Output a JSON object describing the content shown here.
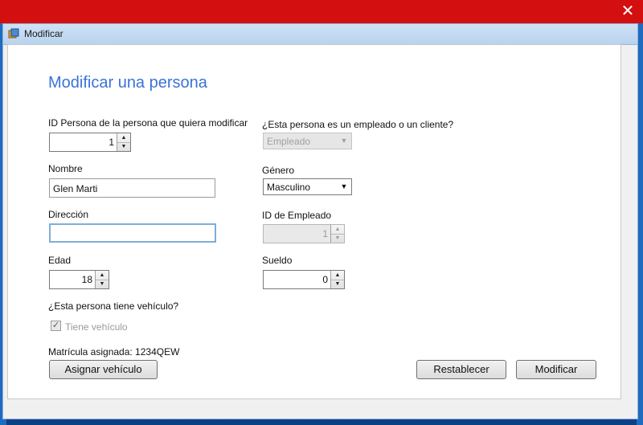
{
  "outer_window": {
    "close_symbol": "✕"
  },
  "dialog": {
    "title": "Modificar",
    "icon": "java-app-icon"
  },
  "form": {
    "heading": "Modificar una persona",
    "id_persona": {
      "label": "ID Persona de la persona que quiera modificar",
      "value": "1"
    },
    "nombre": {
      "label": "Nombre",
      "value": "Glen Marti"
    },
    "direccion": {
      "label": "Dirección",
      "value": ""
    },
    "edad": {
      "label": "Edad",
      "value": "18"
    },
    "vehiculo_question": "¿Esta persona tiene vehículo?",
    "tiene_vehiculo": {
      "label": "Tiene vehículo",
      "checked": true
    },
    "matricula": "Matrícula asignada: 1234QEW",
    "tipo": {
      "label": "¿Esta persona es un empleado o un cliente?",
      "value": "Empleado"
    },
    "genero": {
      "label": "Género",
      "value": "Masculino"
    },
    "id_empleado": {
      "label": "ID de Empleado",
      "value": "1"
    },
    "sueldo": {
      "label": "Sueldo",
      "value": "0"
    }
  },
  "buttons": {
    "asignar": "Asignar vehículo",
    "restablecer": "Restablecer",
    "modificar": "Modificar"
  }
}
